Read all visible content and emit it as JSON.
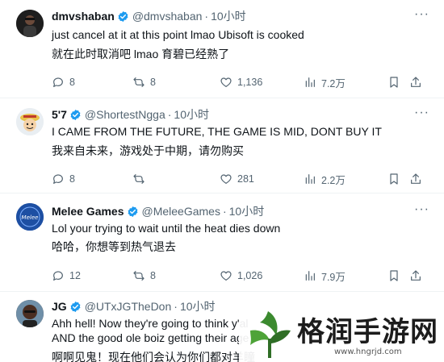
{
  "tweets": [
    {
      "name": "dmvshaban",
      "handle": "@dmvshaban",
      "sep": "·",
      "time": "10小时",
      "text": "just cancel at it at this point lmao Ubisoft is cooked",
      "translation": "就在此时取消吧 lmao 育碧已经熟了",
      "replies": "8",
      "retweets": "8",
      "likes": "1,136",
      "views": "7.2万"
    },
    {
      "name": "5'7",
      "handle": "@ShortestNgga",
      "sep": "·",
      "time": "10小时",
      "text": "I CAME FROM THE FUTURE, THE GAME IS MID, DONT BUY IT",
      "translation": "我来自未来，游戏处于中期，请勿购买",
      "replies": "8",
      "retweets": "",
      "likes": "281",
      "views": "2.2万"
    },
    {
      "name": "Melee Games",
      "handle": "@MeleeGames",
      "sep": "·",
      "time": "10小时",
      "text": "Lol your trying to wait until the heat dies down",
      "translation": "哈哈，你想等到热气退去",
      "replies": "12",
      "retweets": "8",
      "likes": "1,026",
      "views": "7.9万"
    },
    {
      "name": "JG",
      "handle": "@UTxJGTheDon",
      "sep": "·",
      "time": "10小时",
      "text": "Ahh hell! Now they're going to think y'al",
      "text2": "AND the good ole boiz getting their age",
      "translation": "啊啊见鬼！现在他们会认为你们都对羊瞳"
    }
  ],
  "more_label": "···",
  "watermark": {
    "text": "格润手游网",
    "url": "www.hngrjd.com"
  },
  "colors": {
    "text": "#0f1419",
    "secondary": "#536471",
    "verified_badge": "#1d9bf0",
    "watermark_green": "#3b8a2f"
  }
}
